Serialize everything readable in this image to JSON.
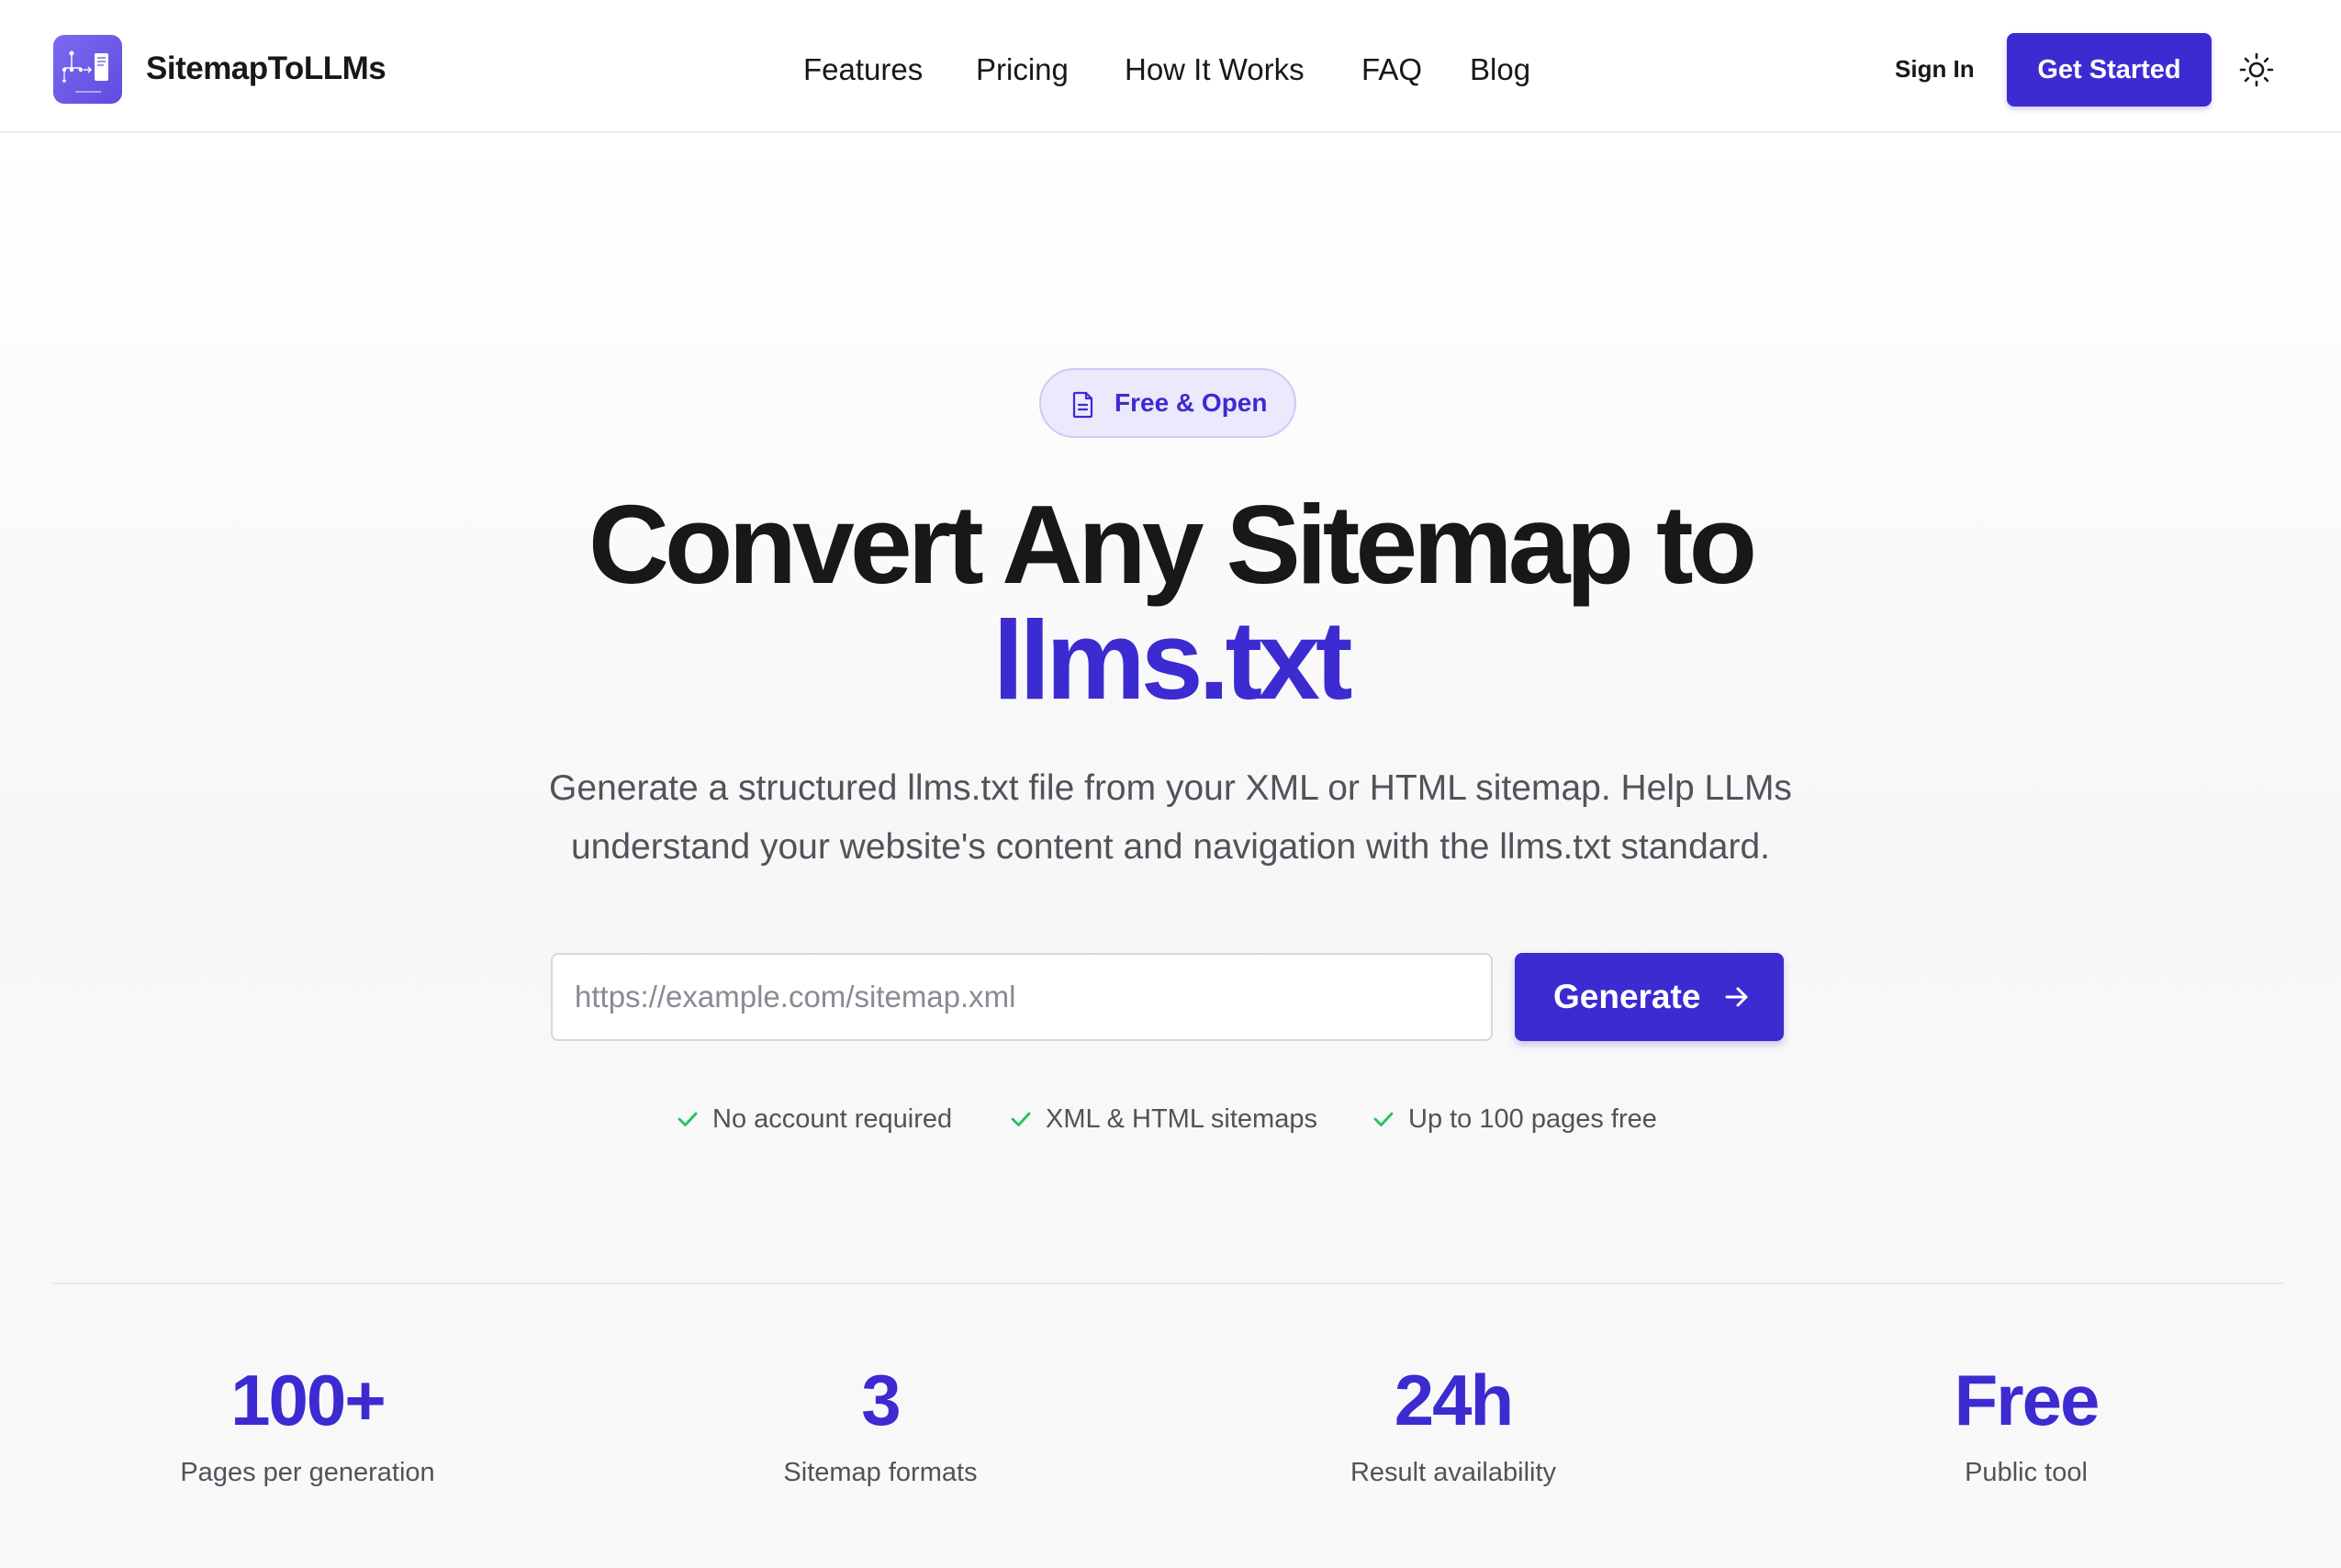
{
  "header": {
    "brand": "SitemapToLLMs",
    "nav": [
      {
        "label": "Features"
      },
      {
        "label": "Pricing"
      },
      {
        "label": "How It Works"
      },
      {
        "label": "FAQ"
      },
      {
        "label": "Blog"
      }
    ],
    "sign_in": "Sign In",
    "get_started": "Get Started"
  },
  "hero": {
    "badge": "Free & Open",
    "headline_line1": "Convert Any Sitemap to",
    "headline_line2": "llms.txt",
    "subtitle": "Generate a structured llms.txt file from your XML or HTML sitemap. Help LLMs understand your website's content and navigation with the llms.txt standard.",
    "url_placeholder": "https://example.com/sitemap.xml",
    "url_value": "",
    "generate": "Generate",
    "features": [
      {
        "label": "No account required"
      },
      {
        "label": "XML & HTML sitemaps"
      },
      {
        "label": "Up to 100 pages free"
      }
    ]
  },
  "stats": [
    {
      "value": "100+",
      "label": "Pages per generation"
    },
    {
      "value": "3",
      "label": "Sitemap formats"
    },
    {
      "value": "24h",
      "label": "Result availability"
    },
    {
      "value": "Free",
      "label": "Public tool"
    }
  ],
  "colors": {
    "accent": "#3c2bd1",
    "text": "#18181b",
    "muted": "#52525b",
    "check": "#22c55e",
    "badge_bg": "#ebe9fb"
  },
  "icons": {
    "logo": "sitemap-logo-icon",
    "theme": "sun-icon",
    "badge": "document-icon",
    "button": "arrow-right-icon",
    "feature": "check-icon"
  }
}
